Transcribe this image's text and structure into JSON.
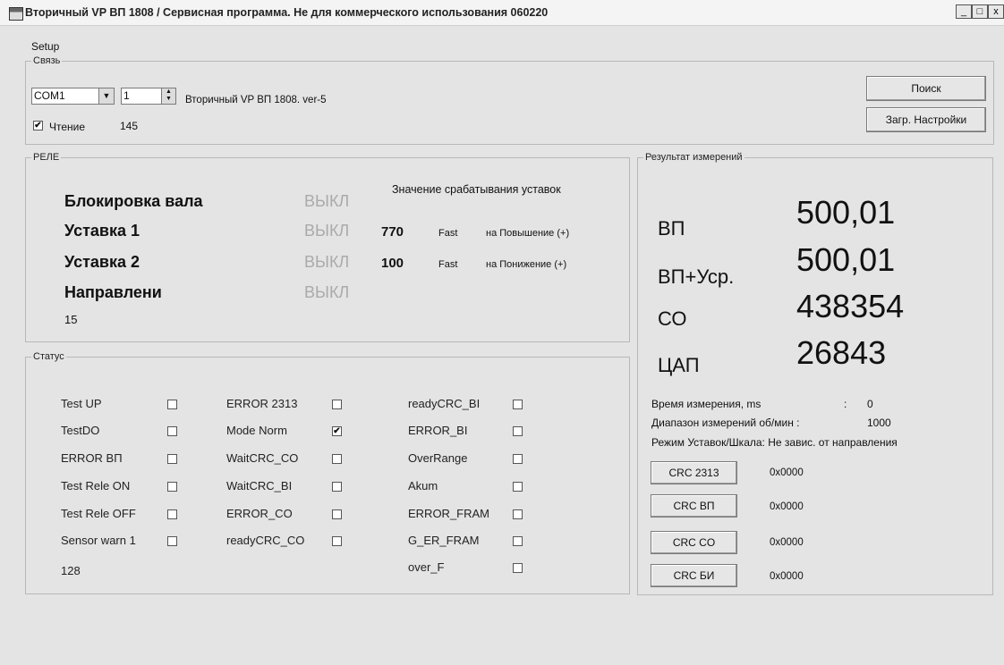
{
  "window": {
    "title": "Вторичный VP  ВП 1808 / Сервисная программа. Не для коммерческого использования 060220",
    "min": "_",
    "max": "□",
    "close": "x"
  },
  "menu": {
    "setup": "Setup"
  },
  "link": {
    "legend": "Связь",
    "port": "COM1",
    "address": "1",
    "device": "Вторичный VP  ВП 1808. ver-5",
    "read_label": "Чтение",
    "read_checked": "✔",
    "read_count": "145",
    "search_button": "Поиск",
    "load_button": "Загр. Настройки"
  },
  "relay": {
    "legend": "РЕЛЕ",
    "setpoint_header": "Значение срабатывания уставок",
    "rows": [
      {
        "name": "Блокировка вала",
        "state": "ВЫКЛ"
      },
      {
        "name": "Уставка 1",
        "state": "ВЫКЛ",
        "value": "770",
        "mode": "Fast",
        "dir": "на Повышение (+)"
      },
      {
        "name": "Уставка 2",
        "state": "ВЫКЛ",
        "value": "100",
        "mode": "Fast",
        "dir": "на Понижение (+)"
      },
      {
        "name": "Направлени",
        "state": "ВЫКЛ"
      }
    ],
    "count": "15"
  },
  "status": {
    "legend": "Статус",
    "col1": [
      "Test UP",
      "TestDO",
      "ERROR ВП",
      "Test Rele ON",
      "Test Rele OFF",
      "Sensor warn 1"
    ],
    "col2": [
      "ERROR 2313",
      "Mode Norm",
      "WaitCRC_CO",
      "WaitCRC_BI",
      "ERROR_CO",
      "readyCRC_CO"
    ],
    "col3": [
      "readyCRC_BI",
      "ERROR_BI",
      "OverRange",
      "Akum",
      "ERROR_FRAM",
      "G_ER_FRAM",
      "over_F"
    ],
    "checked_mark": "✔",
    "count": "128"
  },
  "results": {
    "legend": "Результат измерений",
    "rows": [
      {
        "label": "ВП",
        "value": "500,01"
      },
      {
        "label": "ВП+Уср.",
        "value": "500,01"
      },
      {
        "label": "СО",
        "value": "438354"
      },
      {
        "label": "ЦАП",
        "value": "26843"
      }
    ],
    "time_label": "Время измерения, ms",
    "time_sep": ":",
    "time_value": "0",
    "range_label": "Диапазон измерений об/мин :",
    "range_value": "1000",
    "mode_text": "Режим Уставок/Шкала: Не завис. от направления",
    "crc": [
      {
        "button": "CRC 2313",
        "value": "0x0000"
      },
      {
        "button": "CRC ВП",
        "value": "0x0000"
      },
      {
        "button": "CRC CO",
        "value": "0x0000"
      },
      {
        "button": "CRC БИ",
        "value": "0x0000"
      }
    ]
  }
}
